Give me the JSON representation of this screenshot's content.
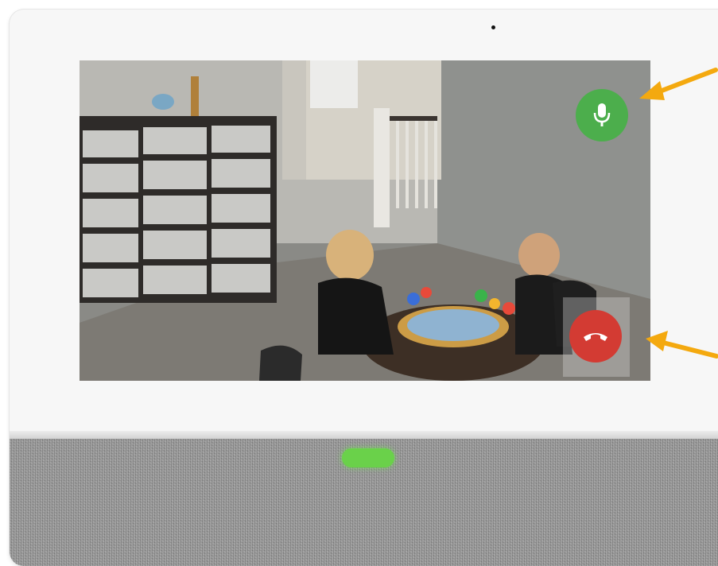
{
  "device": {
    "type": "smart video intercom panel"
  },
  "video_call": {
    "mute_control": {
      "icon": "microphone-icon",
      "color": "#4cae4c"
    },
    "end_call_control": {
      "icon": "hang-up-phone-icon",
      "color": "#d33b33"
    }
  },
  "status_led": {
    "color": "#6ad14a",
    "state": "on"
  },
  "annotations": {
    "arrow_color": "#f4a90f",
    "arrows": [
      "points-to-mute-button",
      "points-to-end-call-button"
    ]
  }
}
